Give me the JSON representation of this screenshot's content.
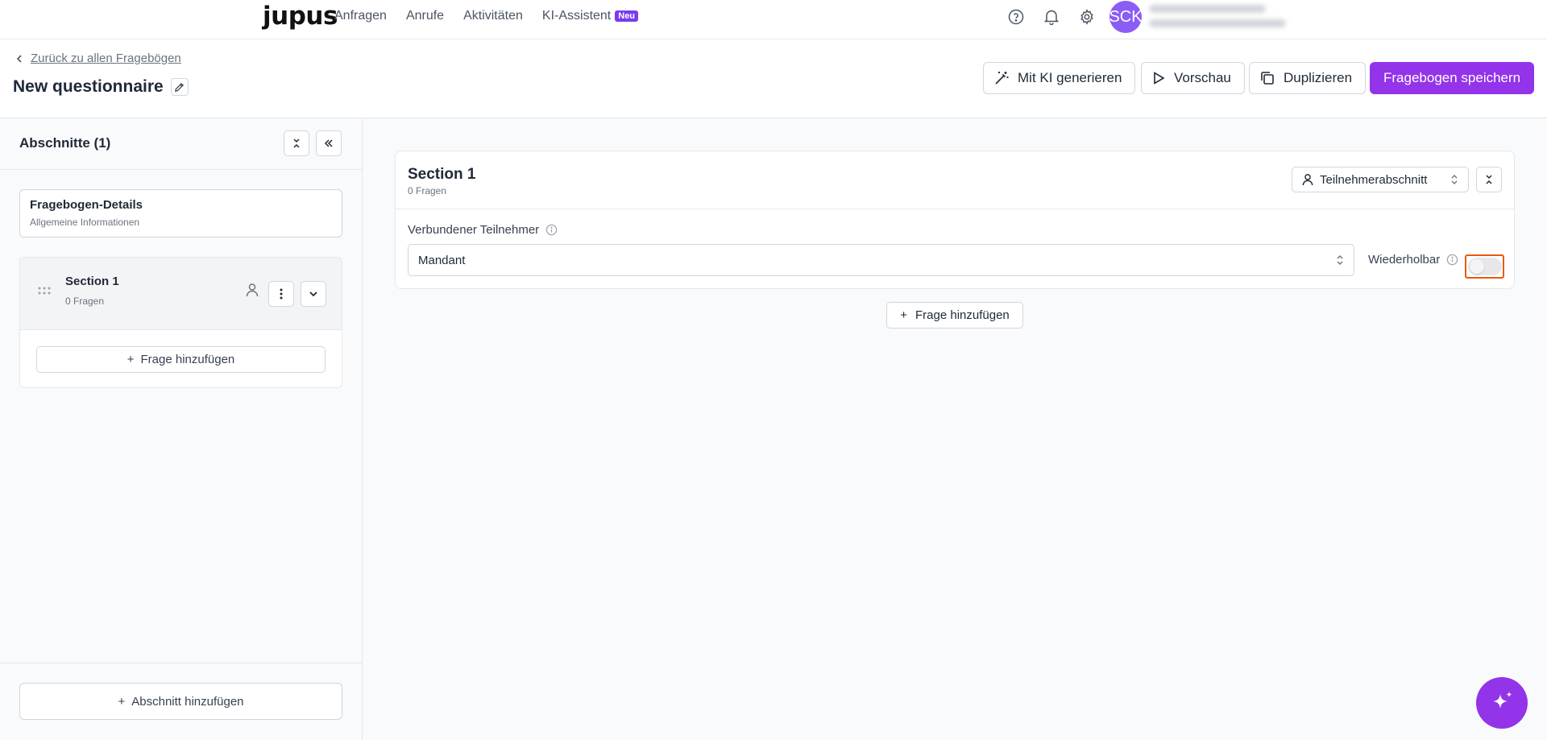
{
  "topbar": {
    "logo": "jupus",
    "nav": [
      {
        "label": "Anfragen"
      },
      {
        "label": "Anrufe"
      },
      {
        "label": "Aktivitäten"
      },
      {
        "label": "KI-Assistent",
        "badge": "Neu"
      }
    ],
    "icons": [
      "help-circle-icon",
      "bell-icon",
      "gear-icon"
    ],
    "avatar_initials": "SCK"
  },
  "header": {
    "back_label": "Zurück zu allen Fragebögen",
    "title": "New questionnaire",
    "buttons": {
      "generate": "Mit KI generieren",
      "preview": "Vorschau",
      "duplicate": "Duplizieren",
      "save": "Fragebogen speichern"
    }
  },
  "sidebar": {
    "title": "Abschnitte (1)",
    "details": {
      "title": "Fragebogen-Details",
      "subtitle": "Allgemeine Informationen"
    },
    "sections": [
      {
        "name": "Section 1",
        "count": "0 Fragen"
      }
    ],
    "add_question": "Frage hinzufügen",
    "add_section": "Abschnitt hinzufügen"
  },
  "main": {
    "section": {
      "title": "Section 1",
      "subtitle": "0 Fragen",
      "section_type": "Teilnehmerabschnitt",
      "linked_participant_label": "Verbundener Teilnehmer",
      "linked_participant_value": "Mandant",
      "repeatable_label": "Wiederholbar",
      "repeatable": false
    },
    "add_question": "Frage hinzufügen"
  },
  "colors": {
    "accent": "#9333ea",
    "badge": "#7c3aed",
    "avatar": "#8b5cf6",
    "focus_outline": "#ea580c"
  }
}
